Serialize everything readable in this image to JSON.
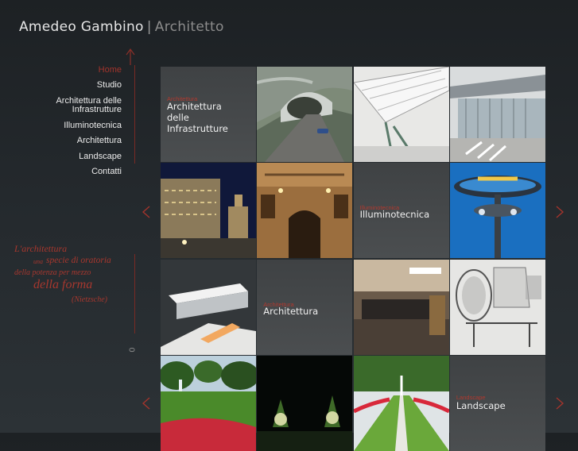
{
  "header": {
    "name": "Amedeo Gambino",
    "separator": "|",
    "role": "Architetto"
  },
  "nav": {
    "items": [
      {
        "label": "Home",
        "active": true
      },
      {
        "label": "Studio"
      },
      {
        "label": "Architettura delle"
      },
      {
        "label": "Infrastrutture"
      },
      {
        "label": "Illuminotecnica"
      },
      {
        "label": "Architettura"
      },
      {
        "label": "Landscape"
      },
      {
        "label": "Contatti"
      }
    ]
  },
  "quote": {
    "l1": "L'architettura",
    "l2a": "una",
    "l2b": "specie di oratoria",
    "l3": "della potenza per mezzo",
    "l4": "della forma",
    "l5": "(Nietzsche)"
  },
  "scroll_indicator": "0",
  "tiles": {
    "infra": {
      "small": "Architettura",
      "big1": "Architettura",
      "big2": "delle",
      "big3": "Infrastrutture"
    },
    "illum": {
      "small": "Illuminotecnica",
      "big": "Illuminotecnica"
    },
    "arch": {
      "small": "Architettura",
      "big": "Architettura"
    },
    "land": {
      "small": "Landscape",
      "big": "Landscape"
    }
  },
  "colors": {
    "accent": "#a3342c",
    "background": "#22272a",
    "tile": "#464a4c"
  }
}
